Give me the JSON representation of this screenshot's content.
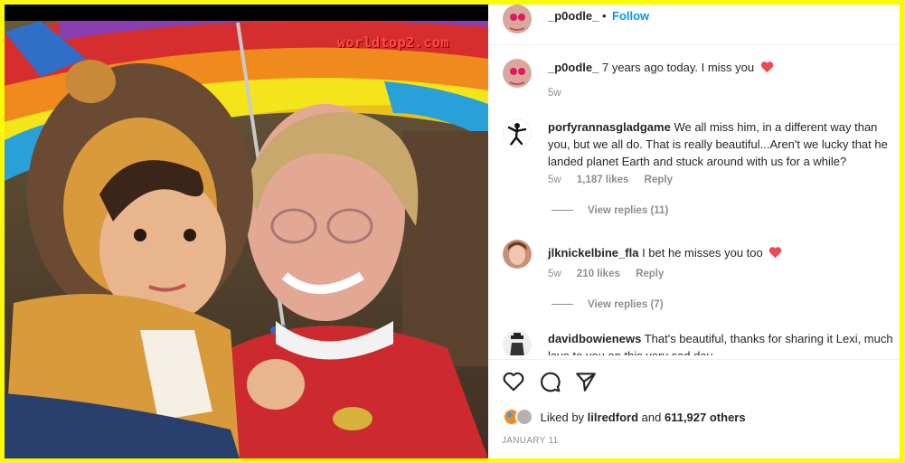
{
  "post": {
    "watermark": "worldtop2.com",
    "author": "_p0odle_",
    "dot": "•",
    "follow_label": "Follow"
  },
  "comments": [
    {
      "username": "_p0odle_",
      "text": "7 years ago today. I miss you",
      "has_heart": true,
      "age": "5w",
      "likes": "",
      "reply": ""
    },
    {
      "username": "porfyrannasgladgame",
      "text": "We all miss him, in a different way than you, but we all do. That is really beautiful...Aren't we lucky that he landed planet Earth and stuck around with us for a while?",
      "age": "5w",
      "likes": "1,187 likes",
      "reply": "Reply",
      "view_replies": "View replies (11)"
    },
    {
      "username": "jlknickelbine_fla",
      "text": "I bet he misses you too",
      "has_heart": true,
      "age": "5w",
      "likes": "210 likes",
      "reply": "Reply",
      "view_replies": "View replies (7)"
    },
    {
      "username": "davidbowienews",
      "text": "That's beautiful, thanks for sharing it Lexi, much love to you on this very sad day",
      "age": "",
      "likes": "",
      "reply": ""
    }
  ],
  "actions": {
    "like_icon": "heart-outline-icon",
    "comment_icon": "comment-bubble-icon",
    "share_icon": "paper-plane-icon"
  },
  "likes": {
    "prefix": "Liked by",
    "user": "lilredford",
    "conj": "and",
    "count": "611,927 others"
  },
  "date": "JANUARY 11",
  "colors": {
    "border": "#ffff00",
    "follow": "#0095f6",
    "heart": "#ed4956",
    "meta": "#8e8e8e"
  }
}
